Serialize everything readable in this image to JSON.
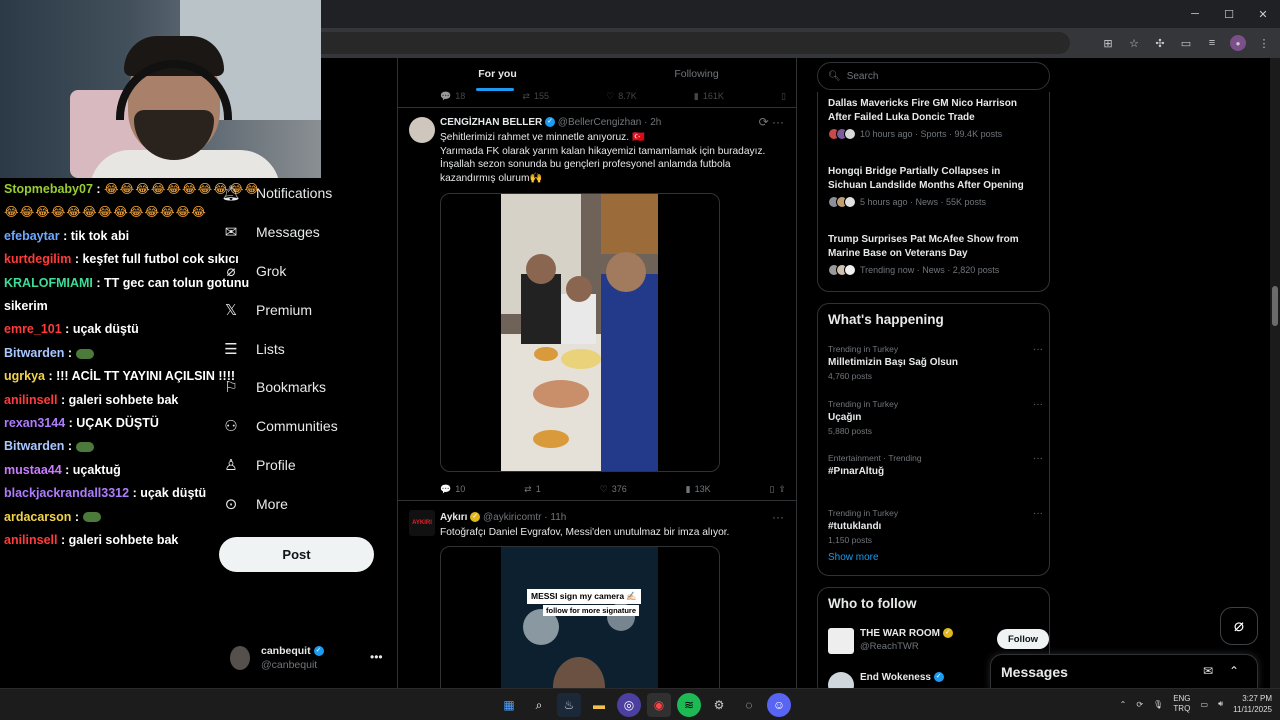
{
  "browser": {
    "controls": {
      "minimize": "─",
      "maximize": "☐",
      "close": "✕"
    }
  },
  "chat": [
    {
      "user": "Stopmebaby07",
      "color": "#9acd32",
      "text": "😂😂😂😂😂😂😂😂😂😂😂😂😂😂😂😂😂😂😂😂😂😂😂"
    },
    {
      "user": "efebaytar",
      "color": "#6fa8ff",
      "text": "tik tok abi"
    },
    {
      "user": "kurtdegilim",
      "color": "#ff3b3b",
      "text": "keşfet full futbol cok sıkıcı"
    },
    {
      "user": "KRALOFMIAMI",
      "color": "#3ddc97",
      "text": "TT gec can tolun gotunu sikerim"
    },
    {
      "user": "emre_101",
      "color": "#ff3b3b",
      "text": "uçak düştü"
    },
    {
      "user": "Bitwarden",
      "color": "#a8c8ff",
      "text": ""
    },
    {
      "user": "ugrkya",
      "color": "#f3d34a",
      "text": "!!! ACİL TT YAYINI AÇILSIN !!!!"
    },
    {
      "user": "anilinsell",
      "color": "#ff3b3b",
      "text": "galeri sohbete bak"
    },
    {
      "user": "rexan3144",
      "color": "#b07cff",
      "text": "UÇAK DÜŞTÜ"
    },
    {
      "user": "Bitwarden",
      "color": "#a8c8ff",
      "text": ""
    },
    {
      "user": "mustaa44",
      "color": "#c87cff",
      "text": "uçaktuğ"
    },
    {
      "user": "blackjackrandall3312",
      "color": "#b07cff",
      "text": "uçak düştü"
    },
    {
      "user": "ardacarson",
      "color": "#f3d34a",
      "text": ""
    },
    {
      "user": "anilinsell",
      "color": "#ff3b3b",
      "text": "galeri sohbete bak"
    }
  ],
  "nav": {
    "items": [
      {
        "label": "Notifications",
        "icon": "bell-icon"
      },
      {
        "label": "Messages",
        "icon": "envelope-icon"
      },
      {
        "label": "Grok",
        "icon": "grok-icon"
      },
      {
        "label": "Premium",
        "icon": "x-logo-icon"
      },
      {
        "label": "Lists",
        "icon": "list-icon"
      },
      {
        "label": "Bookmarks",
        "icon": "bookmark-icon"
      },
      {
        "label": "Communities",
        "icon": "communities-icon"
      },
      {
        "label": "Profile",
        "icon": "person-icon"
      },
      {
        "label": "More",
        "icon": "more-circle-icon"
      }
    ],
    "post_label": "Post",
    "account": {
      "name": "canbequit",
      "handle": "@canbequit"
    }
  },
  "timeline": {
    "tabs": [
      {
        "label": "For you",
        "active": true
      },
      {
        "label": "Following",
        "active": false
      }
    ],
    "prev_actions": {
      "replies": "18",
      "reposts": "155",
      "likes": "8.7K",
      "views": "161K"
    },
    "tweets": [
      {
        "name": "CENGİZHAN BELLER",
        "handle": "@BellerCengizhan",
        "time": "2h",
        "lines": [
          "Şehitlerimizi rahmet ve minnetle anıyoruz. 🇹🇷",
          "Yarımada FK olarak yarım kalan hikayemizi tamamlamak için buradayız.",
          "İnşallah sezon sonunda bu gençleri profesyonel anlamda futbola",
          "kazandırmış olurum🙌"
        ],
        "replies": "10",
        "reposts": "1",
        "likes": "376",
        "views": "13K"
      },
      {
        "name": "Aykırı",
        "handle": "@aykiricomtr",
        "time": "11h",
        "avatar_text": "AYKIRI",
        "lines": [
          "Fotoğrafçı Daniel Evgrafov, Messi'den unutulmaz bir imza alıyor."
        ],
        "media_text_1": "MESSI sign my camera ✍🏻",
        "media_text_2": "follow for more signature"
      }
    ]
  },
  "sidebar": {
    "search_placeholder": "Search",
    "news": [
      {
        "title": "Dallas Mavericks Fire GM Nico Harrison After Failed Luka Doncic Trade",
        "meta": "10 hours ago · Sports · 99.4K posts"
      },
      {
        "title": "Hongqi Bridge Partially Collapses in Sichuan Landslide Months After Opening",
        "meta": "5 hours ago · News · 55K posts"
      },
      {
        "title": "Trump Surprises Pat McAfee Show from Marine Base on Veterans Day",
        "meta": "Trending now · News · 2,820 posts"
      }
    ],
    "happening_title": "What's happening",
    "trends": [
      {
        "context": "Trending in Turkey",
        "name": "Milletimizin Başı Sağ Olsun",
        "posts": "4,760 posts"
      },
      {
        "context": "Trending in Turkey",
        "name": "Uçağın",
        "posts": "5,880 posts"
      },
      {
        "context": "Entertainment · Trending",
        "name": "#PınarAltuğ",
        "posts": ""
      },
      {
        "context": "Trending in Turkey",
        "name": "#tutuklandı",
        "posts": "1,150 posts"
      }
    ],
    "show_more": "Show more",
    "who_to_follow_title": "Who to follow",
    "follow": [
      {
        "name": "THE WAR ROOM",
        "handle": "@ReachTWR",
        "button": "Follow"
      },
      {
        "name": "End Wokeness",
        "handle": "",
        "button": ""
      }
    ],
    "messages_title": "Messages"
  },
  "taskbar": {
    "lang_top": "ENG",
    "lang_bottom": "TRQ",
    "time": "3:27 PM",
    "date": "11/11/2025"
  }
}
